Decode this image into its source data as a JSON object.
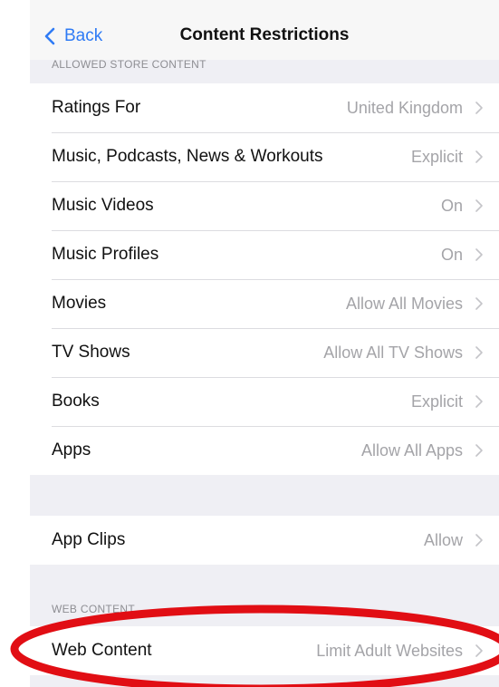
{
  "nav": {
    "back_label": "Back",
    "title": "Content Restrictions"
  },
  "sections": {
    "store": {
      "header": "ALLOWED STORE CONTENT",
      "rows": [
        {
          "label": "Ratings For",
          "value": "United Kingdom"
        },
        {
          "label": "Music, Podcasts, News & Workouts",
          "value": "Explicit"
        },
        {
          "label": "Music Videos",
          "value": "On"
        },
        {
          "label": "Music Profiles",
          "value": "On"
        },
        {
          "label": "Movies",
          "value": "Allow All Movies"
        },
        {
          "label": "TV Shows",
          "value": "Allow All TV Shows"
        },
        {
          "label": "Books",
          "value": "Explicit"
        },
        {
          "label": "Apps",
          "value": "Allow All Apps"
        }
      ]
    },
    "clips": {
      "rows": [
        {
          "label": "App Clips",
          "value": "Allow"
        }
      ]
    },
    "web": {
      "header": "WEB CONTENT",
      "rows": [
        {
          "label": "Web Content",
          "value": "Limit Adult Websites"
        }
      ]
    }
  },
  "icons": {
    "back": "chevron-left-icon",
    "disclosure": "chevron-right-icon"
  },
  "colors": {
    "accent": "#2f7bf5",
    "highlight_ellipse": "#e10e14",
    "grouped_background": "#efeff4"
  }
}
